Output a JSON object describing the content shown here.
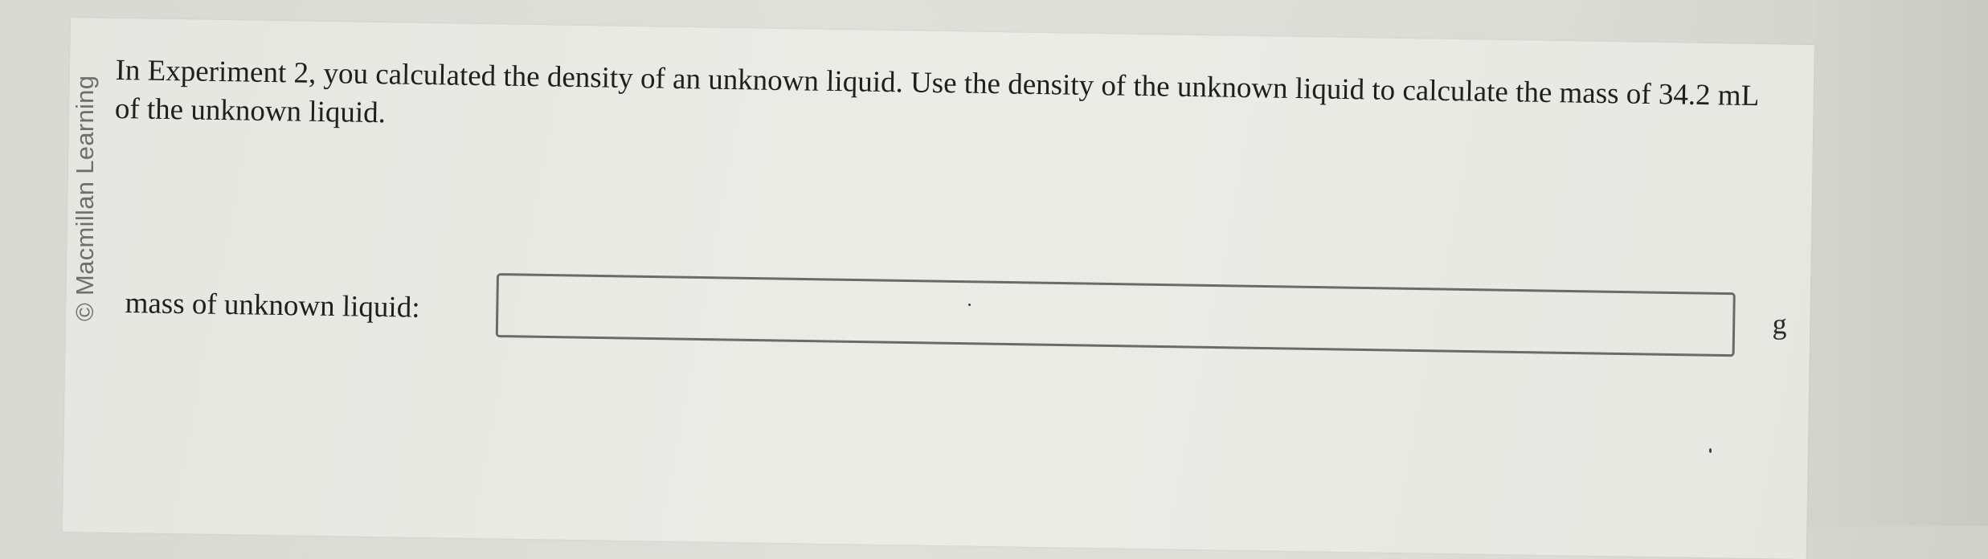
{
  "watermark": "© Macmillan Learning",
  "question": {
    "text": "In Experiment 2, you calculated the density of an unknown liquid. Use the density of the unknown liquid to calculate the mass of 34.2 mL of the unknown liquid."
  },
  "answer": {
    "label": "mass of unknown liquid:",
    "value": "",
    "placeholder": "",
    "unit": "g"
  }
}
